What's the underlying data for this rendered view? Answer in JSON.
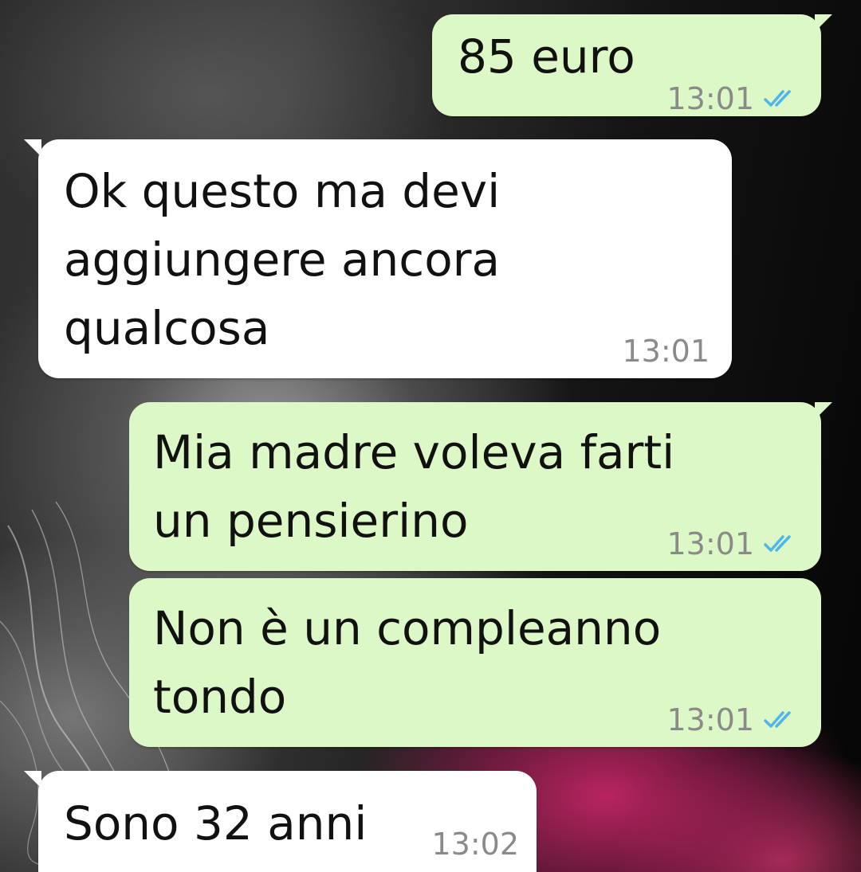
{
  "messages": [
    {
      "direction": "outgoing",
      "text": "85 euro",
      "time": "13:01",
      "status": "read-double-check-icon"
    },
    {
      "direction": "incoming",
      "lines": [
        "Ok questo ma devi",
        "aggiungere ancora",
        "qualcosa"
      ],
      "time": "13:01"
    },
    {
      "direction": "outgoing",
      "lines": [
        "Mia madre voleva farti",
        "un pensierino"
      ],
      "time": "13:01",
      "status": "read-double-check-icon"
    },
    {
      "direction": "outgoing",
      "lines": [
        "Non è un compleanno",
        "tondo"
      ],
      "time": "13:01",
      "status": "read-double-check-icon"
    },
    {
      "direction": "incoming",
      "text": "Sono 32 anni",
      "time": "13:02"
    }
  ],
  "colors": {
    "outgoing_bubble": "#dcf8c6",
    "incoming_bubble": "#ffffff",
    "read_check": "#4fb6ec",
    "timestamp": "#8a8a8a"
  }
}
